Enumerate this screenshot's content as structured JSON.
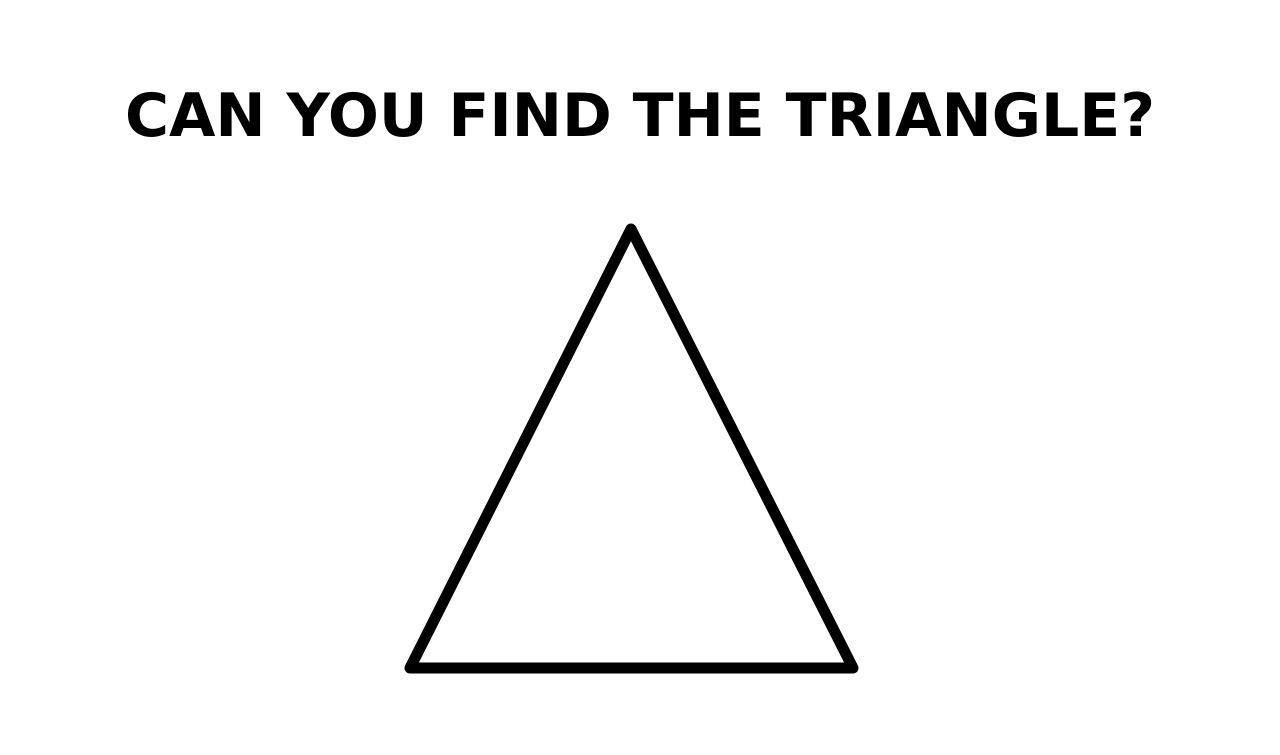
{
  "headline": "CAN YOU FIND THE TRIANGLE?",
  "colors": {
    "background": "#ffffff",
    "foreground": "#000000"
  },
  "figure": {
    "shape": "triangle-outline-icon"
  }
}
